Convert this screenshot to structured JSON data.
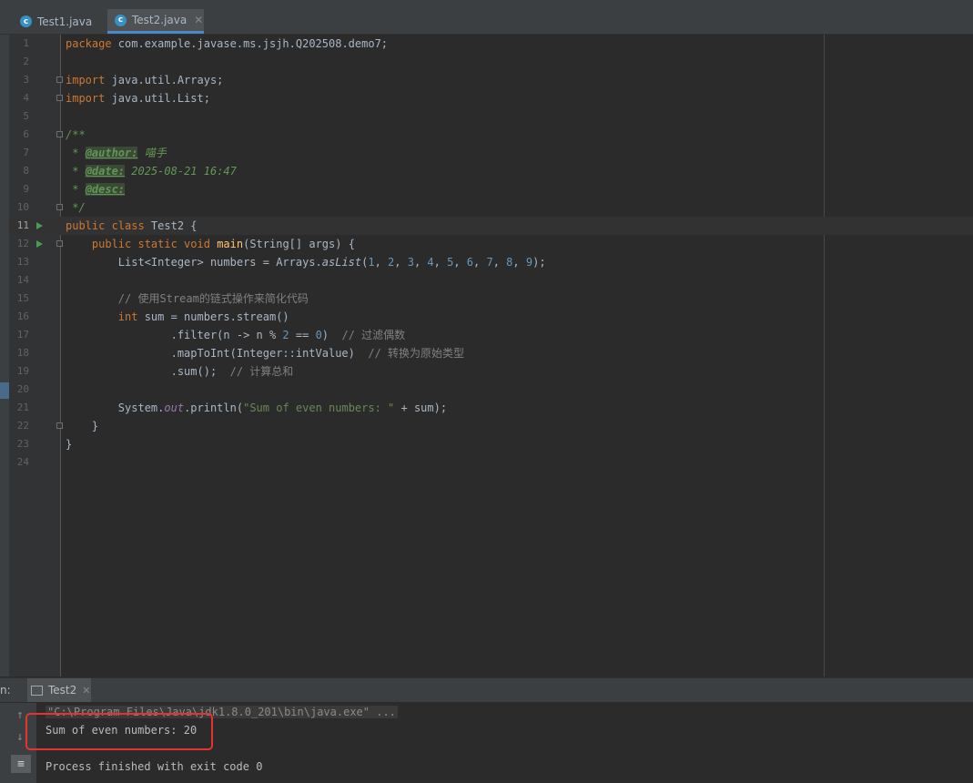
{
  "tabs": [
    {
      "label": "Test1.java",
      "icon": "c",
      "active": false
    },
    {
      "label": "Test2.java",
      "icon": "c",
      "active": true
    }
  ],
  "editor": {
    "lines": [
      {
        "n": "1",
        "html": "<span class='kw'>package</span> com.example.javase.ms.jsjh.Q202508.demo7;"
      },
      {
        "n": "2",
        "html": ""
      },
      {
        "n": "3",
        "html": "<span class='kw'>import</span> java.util.Arrays;"
      },
      {
        "n": "4",
        "html": "<span class='kw'>import</span> java.util.List;"
      },
      {
        "n": "5",
        "html": ""
      },
      {
        "n": "6",
        "html": "<span class='doc'>/**</span>"
      },
      {
        "n": "7",
        "html": "<span class='doc'> * </span><span class='tag'>@author:</span><span class='doc'> 喵手</span>"
      },
      {
        "n": "8",
        "html": "<span class='doc'> * </span><span class='tag'>@date:</span><span class='doc'> 2025-08-21 16:47</span>"
      },
      {
        "n": "9",
        "html": "<span class='doc'> * </span><span class='tag'>@desc:</span>"
      },
      {
        "n": "10",
        "html": "<span class='doc'> */</span>"
      },
      {
        "n": "11",
        "html": "<span class='kw'>public class</span> Test2 {"
      },
      {
        "n": "12",
        "html": "    <span class='kw'>public static void</span> <span class='fn'>main</span>(String[] args) {"
      },
      {
        "n": "13",
        "html": "        List&lt;Integer&gt; numbers = Arrays.<span class='ital'>asList</span>(<span class='num'>1</span>, <span class='num'>2</span>, <span class='num'>3</span>, <span class='num'>4</span>, <span class='num'>5</span>, <span class='num'>6</span>, <span class='num'>7</span>, <span class='num'>8</span>, <span class='num'>9</span>);"
      },
      {
        "n": "14",
        "html": ""
      },
      {
        "n": "15",
        "html": "        <span class='cm'>// 使用Stream的链式操作来简化代码</span>"
      },
      {
        "n": "16",
        "html": "        <span class='kw'>int</span> sum = numbers.stream()"
      },
      {
        "n": "17",
        "html": "                .filter(n -&gt; n % <span class='num'>2</span> == <span class='num'>0</span>)  <span class='cm'>// 过滤偶数</span>"
      },
      {
        "n": "18",
        "html": "                .mapToInt(Integer::intValue)  <span class='cm'>// 转换为原始类型</span>"
      },
      {
        "n": "19",
        "html": "                .sum();  <span class='cm'>// 计算总和</span>"
      },
      {
        "n": "20",
        "html": ""
      },
      {
        "n": "21",
        "html": "        System.<span class='stat'>out</span>.println(<span class='str'>\"Sum of even numbers: \"</span> + sum);"
      },
      {
        "n": "22",
        "html": "    }"
      },
      {
        "n": "23",
        "html": "}"
      },
      {
        "n": "24",
        "html": ""
      }
    ]
  },
  "run": {
    "label": "n:",
    "tab": "Test2",
    "command": "\"C:\\Program Files\\Java\\jdk1.8.0_201\\bin\\java.exe\" ...",
    "output": "Sum of even numbers: 20",
    "exit": "Process finished with exit code 0"
  }
}
